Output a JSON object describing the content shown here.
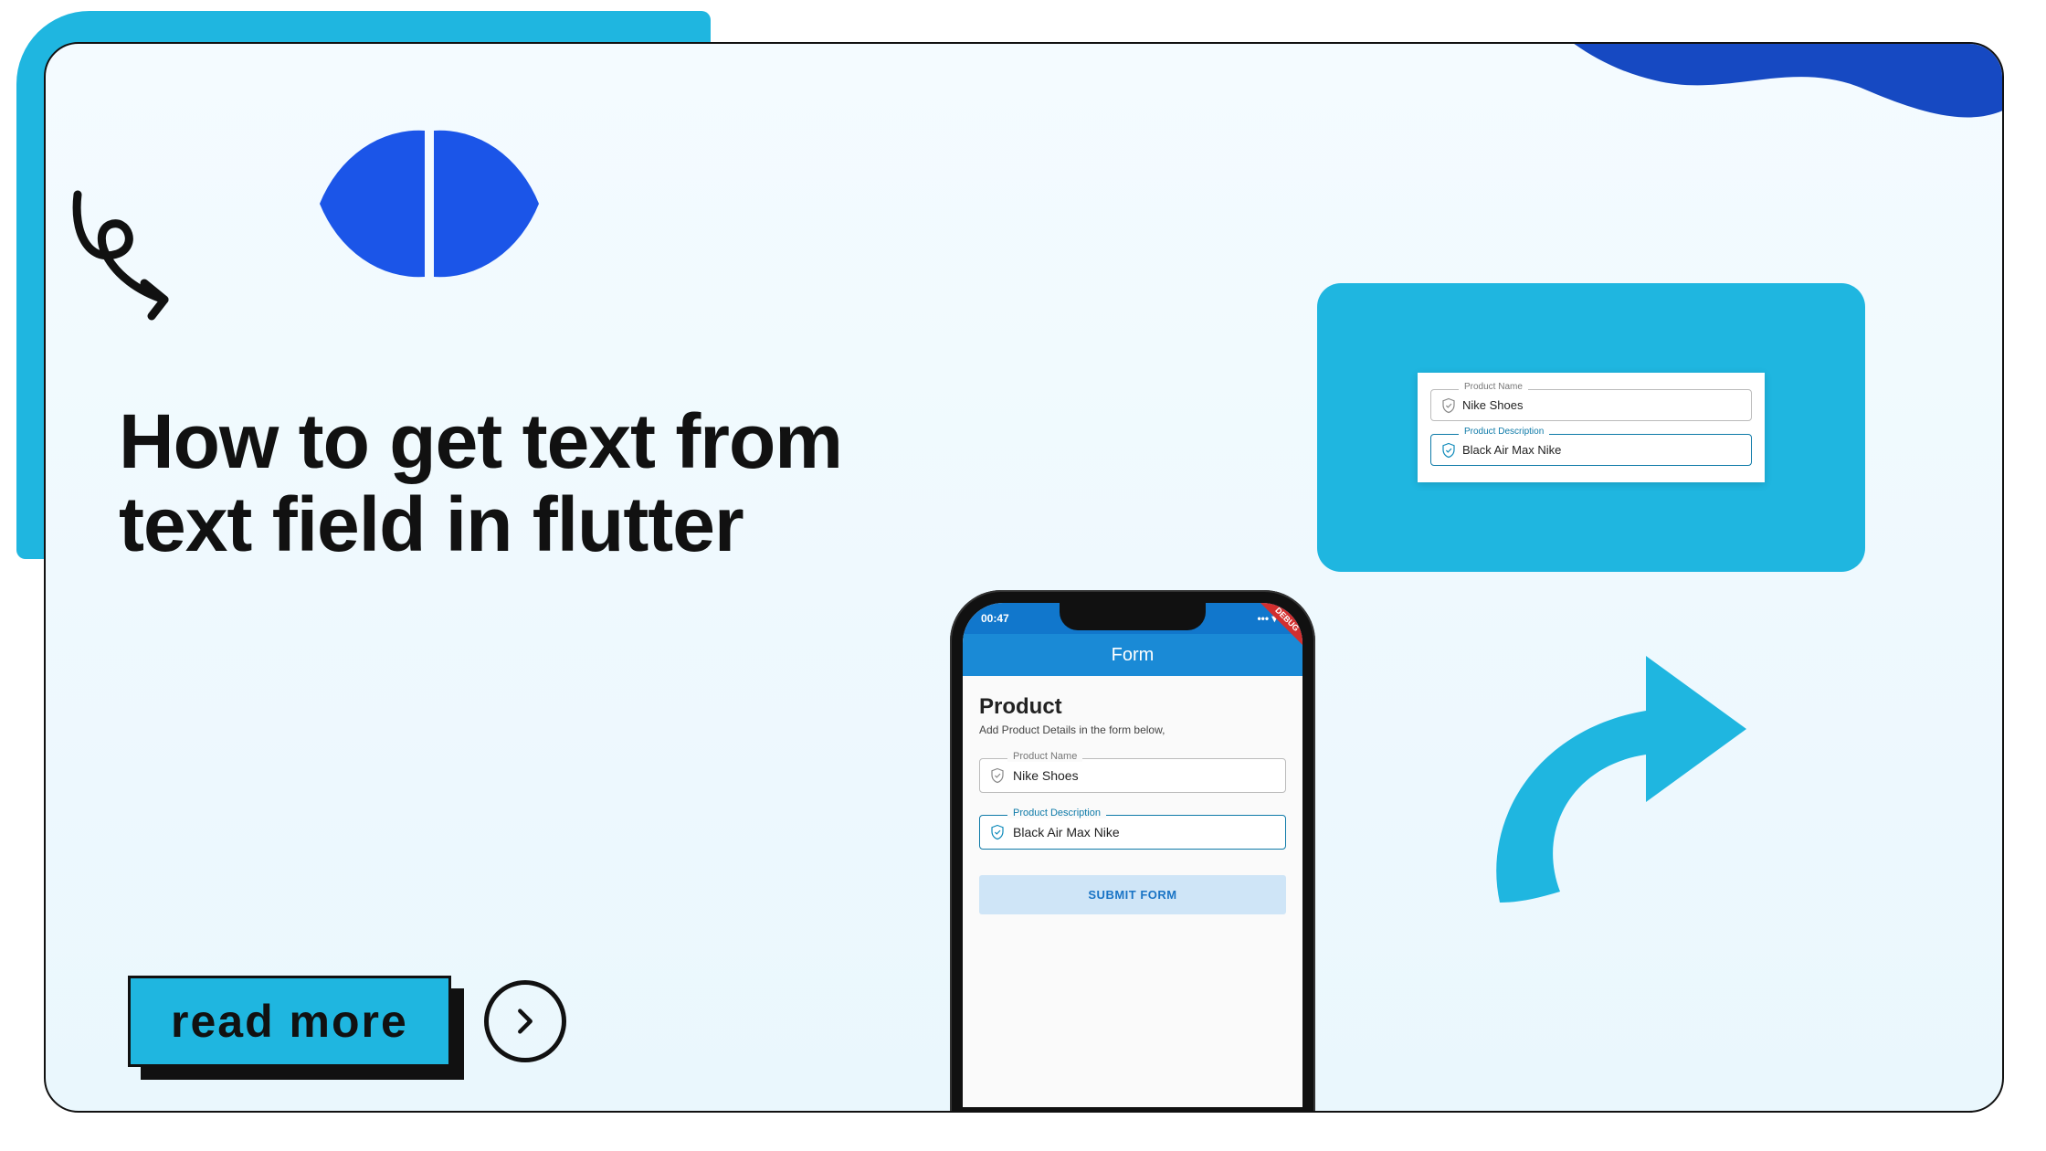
{
  "headline": "How to get text from text field in flutter",
  "read_more_label": "read more",
  "phone": {
    "status_time": "00:47",
    "debug_label": "DEBUG",
    "appbar_title": "Form",
    "heading": "Product",
    "subheading": "Add Product Details in the form below,",
    "field1_label": "Product Name",
    "field1_value": "Nike Shoes",
    "field2_label": "Product Description",
    "field2_value": "Black Air Max Nike",
    "submit_label": "SUBMIT FORM"
  },
  "callout": {
    "field1_label": "Product Name",
    "field1_value": "Nike Shoes",
    "field2_label": "Product Description",
    "field2_value": "Black Air Max Nike"
  }
}
